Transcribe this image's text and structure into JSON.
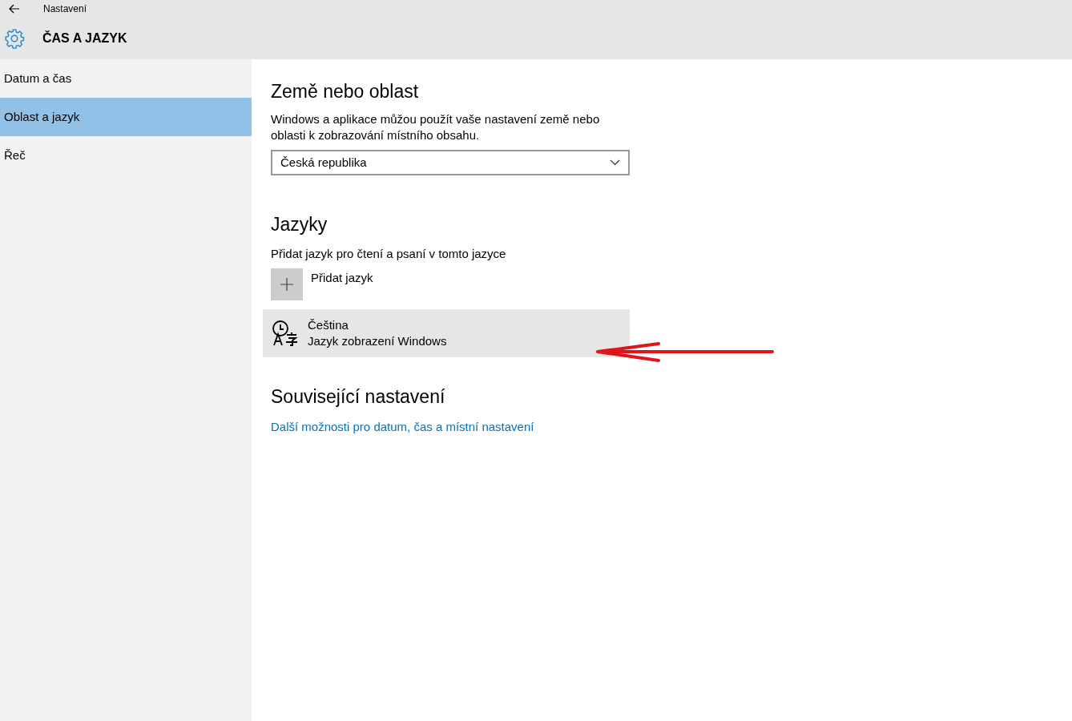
{
  "window": {
    "title": "Nastavení"
  },
  "header": {
    "title": "ČAS A JAZYK"
  },
  "sidebar": {
    "items": [
      {
        "label": "Datum a čas",
        "selected": false
      },
      {
        "label": "Oblast a jazyk",
        "selected": true
      },
      {
        "label": "Řeč",
        "selected": false
      }
    ]
  },
  "region": {
    "heading": "Země nebo oblast",
    "description": "Windows a aplikace můžou použít vaše nastavení země nebo oblasti k zobrazování místního obsahu.",
    "dropdown": {
      "value": "Česká republika"
    }
  },
  "languages": {
    "heading": "Jazyky",
    "description": "Přidat jazyk pro čtení a psaní v tomto jazyce",
    "add_button": "Přidat jazyk",
    "items": [
      {
        "name": "Čeština",
        "subtitle": "Jazyk zobrazení Windows"
      }
    ]
  },
  "related": {
    "heading": "Související nastavení",
    "link": "Další možnosti pro datum, čas a místní nastavení"
  }
}
